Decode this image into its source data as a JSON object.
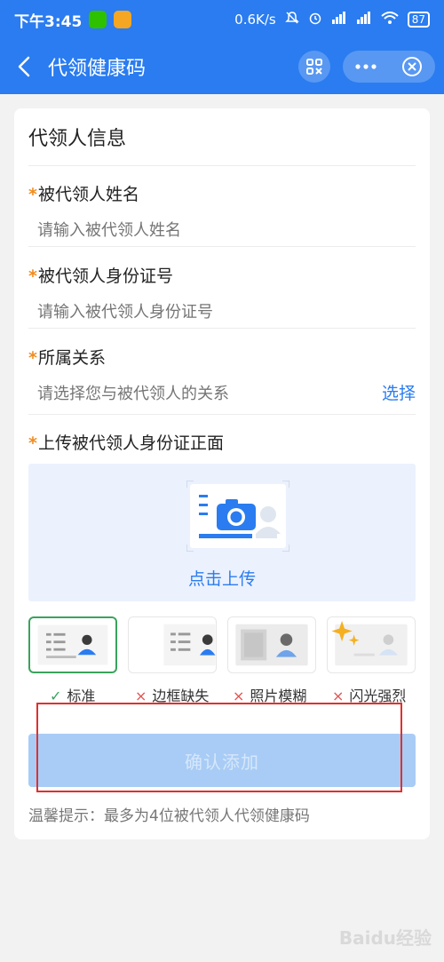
{
  "status_bar": {
    "time": "下午3:45",
    "network_speed": "0.6K/s",
    "battery": "87"
  },
  "nav": {
    "title": "代领健康码"
  },
  "form": {
    "section_title": "代领人信息",
    "required_mark": "*",
    "name_label": "被代领人姓名",
    "name_placeholder": "请输入被代领人姓名",
    "id_label": "被代领人身份证号",
    "id_placeholder": "请输入被代领人身份证号",
    "relation_label": "所属关系",
    "relation_placeholder": "请选择您与被代领人的关系",
    "relation_select": "选择",
    "upload_label": "上传被代领人身份证正面",
    "upload_text": "点击上传"
  },
  "samples": [
    {
      "mark": "✓",
      "label": "标准",
      "status": "ok"
    },
    {
      "mark": "×",
      "label": "边框缺失",
      "status": "bad"
    },
    {
      "mark": "×",
      "label": "照片模糊",
      "status": "bad"
    },
    {
      "mark": "×",
      "label": "闪光强烈",
      "status": "bad"
    }
  ],
  "confirm_button": "确认添加",
  "tip": "温馨提示：最多为4位被代领人代领健康码",
  "watermark": "Baidu经验",
  "colors": {
    "primary": "#2a7cf0",
    "required": "#f08c1e",
    "ok": "#3aa35c",
    "bad": "#e05555",
    "highlight": "#e0302e"
  }
}
